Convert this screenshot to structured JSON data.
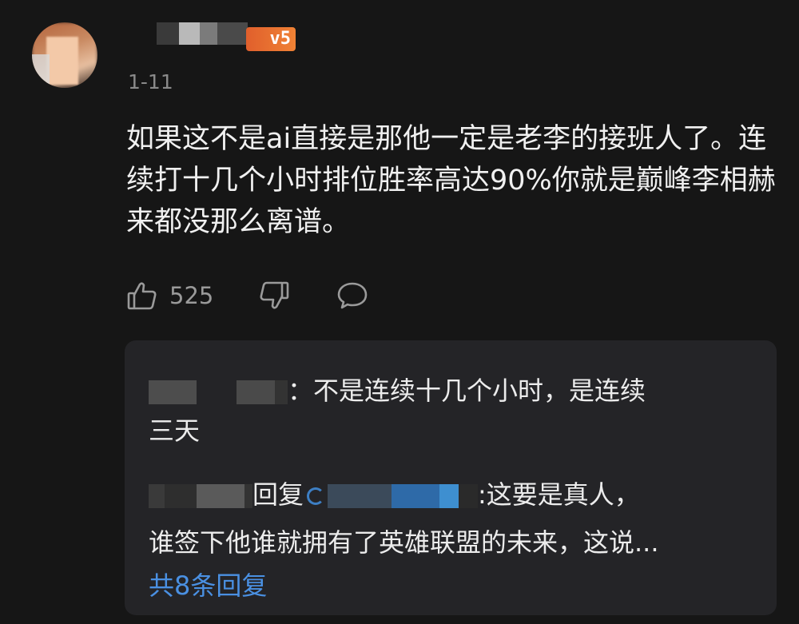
{
  "comment": {
    "date": "1-11",
    "level_badge": "v5",
    "text": "如果这不是ai直接是那他一定是老李的接班人了。连续打十几个小时排位胜率高达90%你就是巅峰李相赫来都没那么离谱。",
    "like_count": "525"
  },
  "replies": [
    {
      "text_line1": "：不是连续十几个小时，是连续",
      "text_line2": "三天"
    },
    {
      "reply_word": "回复",
      "text_line1": ":这要是真人，",
      "text_line2": "谁签下他谁就拥有了英雄联盟的未来，这说..."
    }
  ],
  "more_replies_label": "共8条回复",
  "colors": {
    "background": "#161616",
    "reply_box": "#242427",
    "link": "#4a90e2",
    "badge": "#f08235"
  },
  "icons": [
    "thumbs-up-icon",
    "thumbs-down-icon",
    "speech-bubble-icon"
  ]
}
